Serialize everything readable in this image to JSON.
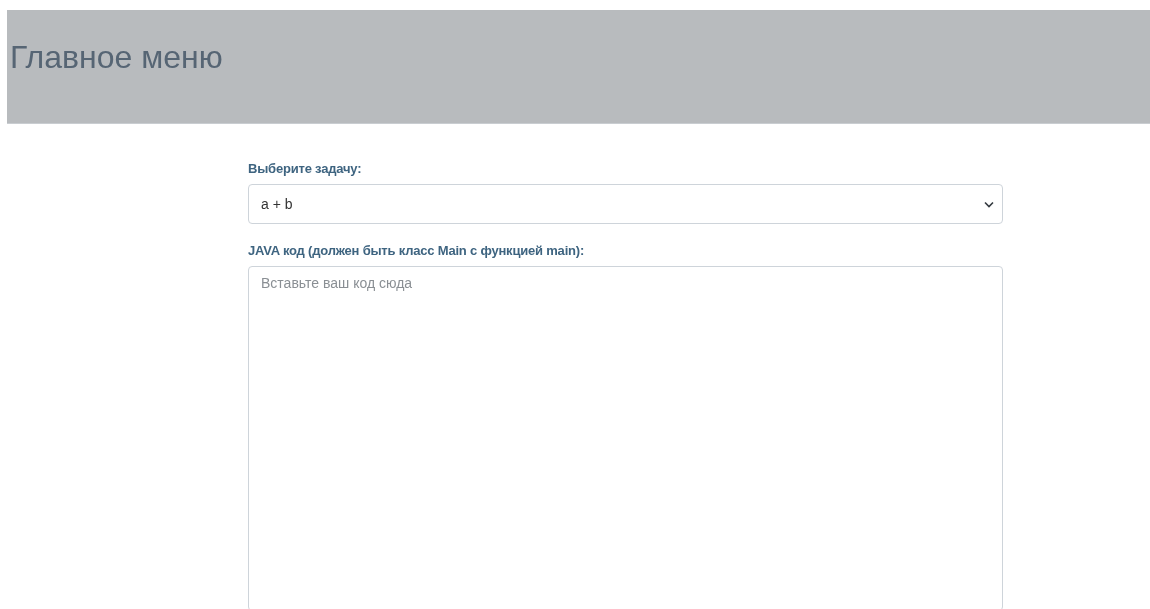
{
  "header": {
    "title": "Главное меню"
  },
  "task_select": {
    "label": "Выберите задачу:",
    "value": "a + b"
  },
  "code_field": {
    "label": "JAVA код (должен быть класс Main с функцией main):",
    "placeholder": "Вставьте ваш код сюда"
  }
}
